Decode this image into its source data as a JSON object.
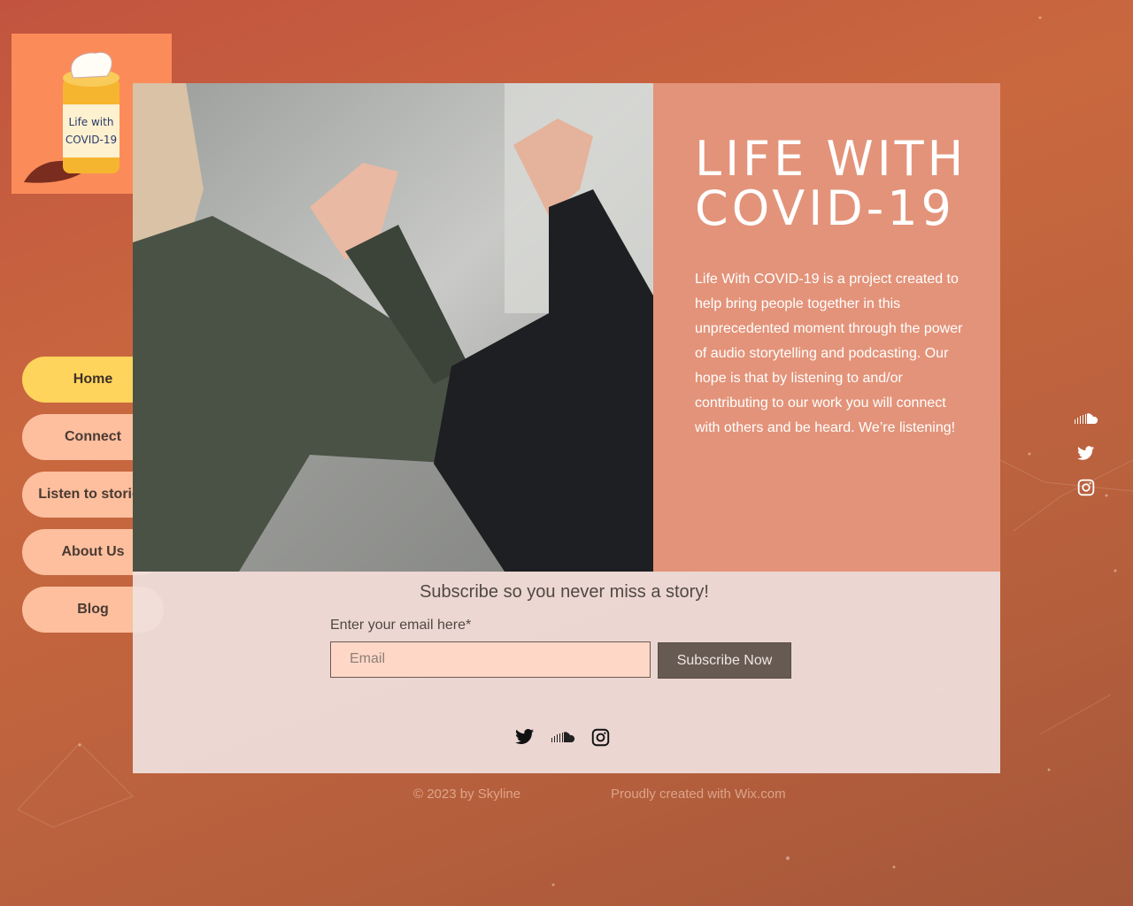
{
  "logo": {
    "text_line1": "Life with",
    "text_line2": "COVID-19"
  },
  "nav": {
    "items": [
      {
        "label": "Home",
        "active": true
      },
      {
        "label": "Connect",
        "active": false
      },
      {
        "label": "Listen to stories",
        "active": false
      },
      {
        "label": "About Us",
        "active": false
      },
      {
        "label": "Blog",
        "active": false
      }
    ]
  },
  "hero": {
    "title": "LIFE WITH\nCOVID-19",
    "description": "Life With COVID-19 is a project created to help bring people together in this unprecedented moment through the power of audio storytelling and podcasting. Our hope is that by listening to and/or contributing to our work you will connect with others and be heard. We’re listening!"
  },
  "subscribe": {
    "heading": "Subscribe so you never miss a story!",
    "email_label": "Enter your email here*",
    "email_placeholder": "Email",
    "button_label": "Subscribe Now",
    "social_icons": [
      "twitter-icon",
      "soundcloud-icon",
      "instagram-icon"
    ]
  },
  "side_social": {
    "icons": [
      "soundcloud-icon",
      "twitter-icon",
      "instagram-icon"
    ]
  },
  "footer": {
    "copyright": "© 2023 by Skyline",
    "credit": "Proudly created with Wix.com"
  },
  "colors": {
    "nav_active": "#fed45c",
    "nav_inactive": "#fdbf9e",
    "hero_panel": "#e39379",
    "subscribe_button": "#665a53",
    "email_field": "#fed7c7"
  }
}
